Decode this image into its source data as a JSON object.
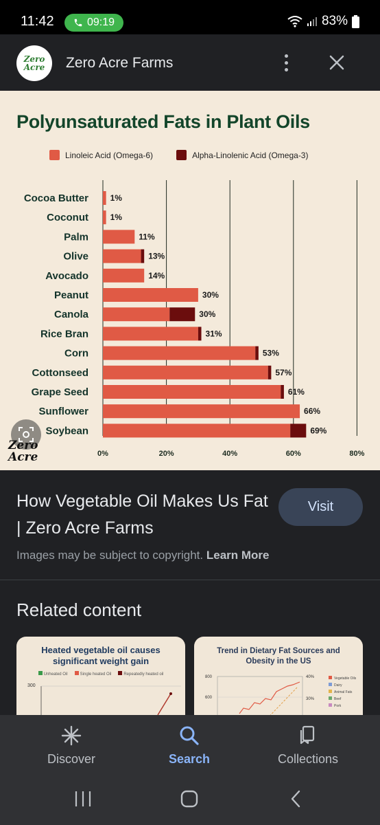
{
  "status": {
    "time": "11:42",
    "call_time": "09:19",
    "battery": "83%"
  },
  "header": {
    "logo_text": "Zero Acre",
    "title": "Zero Acre Farms"
  },
  "chart_image": {
    "title": "Polyunsaturated Fats in Plant Oils",
    "legend": [
      {
        "label": "Linoleic Acid (Omega-6)",
        "color": "#e05a45"
      },
      {
        "label": "Alpha-Linolenic Acid (Omega-3)",
        "color": "#6b0d0d"
      }
    ],
    "watermark": "Zero Acre"
  },
  "chart_data": {
    "type": "bar",
    "orientation": "horizontal",
    "stacked": true,
    "title": "Polyunsaturated Fats in Plant Oils",
    "categories": [
      "Cocoa Butter",
      "Coconut",
      "Palm",
      "Olive",
      "Avocado",
      "Peanut",
      "Canola",
      "Rice Bran",
      "Corn",
      "Cottonseed",
      "Grape Seed",
      "Sunflower",
      "Soybean"
    ],
    "series": [
      {
        "name": "Linoleic Acid (Omega-6)",
        "color": "#e05a45",
        "values": [
          1,
          1,
          10,
          12,
          13,
          30,
          21,
          30,
          48,
          52,
          56,
          62,
          59
        ]
      },
      {
        "name": "Alpha-Linolenic Acid (Omega-3)",
        "color": "#6b0d0d",
        "values": [
          0,
          0,
          0,
          1,
          0,
          0,
          8,
          1,
          1,
          1,
          1,
          0,
          5
        ]
      }
    ],
    "data_labels": [
      "1%",
      "1%",
      "11%",
      "13%",
      "14%",
      "30%",
      "30%",
      "31%",
      "53%",
      "57%",
      "61%",
      "66%",
      "69%"
    ],
    "x_ticks": [
      "0%",
      "20%",
      "40%",
      "60%",
      "80%"
    ],
    "xlim": [
      0,
      80
    ],
    "grid": true
  },
  "result": {
    "title": "How Vegetable Oil Makes Us Fat | Zero Acre Farms",
    "visit_label": "Visit",
    "copyright_text": "Images may be subject to copyright.",
    "learn_more": "Learn More"
  },
  "related": {
    "title": "Related content",
    "cards": [
      {
        "title": "Heated vegetable oil causes significant weight gain",
        "legend": [
          "Unheated Oil",
          "Single heated Oil",
          "Repeatedly heated oil"
        ],
        "y_tick": "300"
      },
      {
        "title": "Trend in Dietary Fat Sources and Obesity in the US",
        "y_ticks": [
          "800",
          "600"
        ],
        "right_ticks": [
          "40%",
          "30%"
        ],
        "legend": [
          "Vegetable Oils",
          "Dairy",
          "Animal Fats",
          "Beef",
          "Pork"
        ]
      }
    ]
  },
  "nav": {
    "discover": "Discover",
    "search": "Search",
    "collections": "Collections"
  }
}
